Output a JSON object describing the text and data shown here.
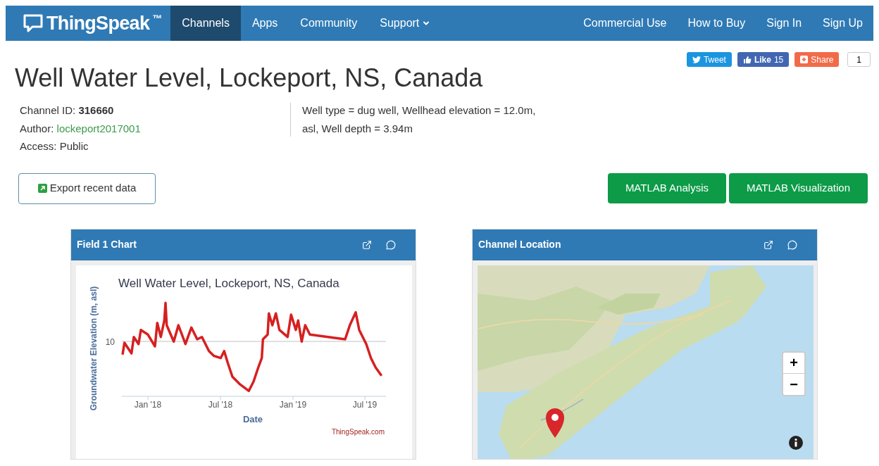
{
  "nav": {
    "brand": "ThingSpeak",
    "trademark": "™",
    "items": [
      {
        "label": "Channels",
        "selected": true,
        "dropdown": false
      },
      {
        "label": "Apps",
        "selected": false,
        "dropdown": false
      },
      {
        "label": "Community",
        "selected": false,
        "dropdown": false
      },
      {
        "label": "Support",
        "selected": false,
        "dropdown": true
      }
    ],
    "right_items": [
      "Commercial Use",
      "How to Buy",
      "Sign In",
      "Sign Up"
    ]
  },
  "social": {
    "tweet": "Tweet",
    "like": "Like",
    "like_count": "15",
    "share": "Share",
    "share_count": "1"
  },
  "title": "Well Water Level, Lockeport, NS, Canada",
  "channel": {
    "id_label": "Channel ID:",
    "id": "316660",
    "author_label": "Author:",
    "author": "lockeport2017001",
    "access": "Access: Public",
    "description": [
      "Well type = dug well, Wellhead elevation = 12.0m,",
      "asl, Well depth = 3.94m"
    ]
  },
  "export_button": "Export recent data",
  "matlab_buttons": [
    "MATLAB Analysis",
    "MATLAB Visualization"
  ],
  "panels": [
    {
      "title": "Field 1 Chart",
      "kind": "chart",
      "chart": {
        "title": "Well Water Level, Lockeport, NS, Canada",
        "ylabel": "Groundwater Elevation (m, asl)",
        "ytick": "10",
        "xticks": [
          "Jan '18",
          "Jul '18",
          "Jan '19",
          "Jul '19"
        ],
        "xlabel": "Date",
        "credit": "ThingSpeak.com"
      }
    },
    {
      "title": "Channel Location",
      "kind": "map",
      "zoom_in": "+",
      "zoom_out": "−"
    }
  ]
}
